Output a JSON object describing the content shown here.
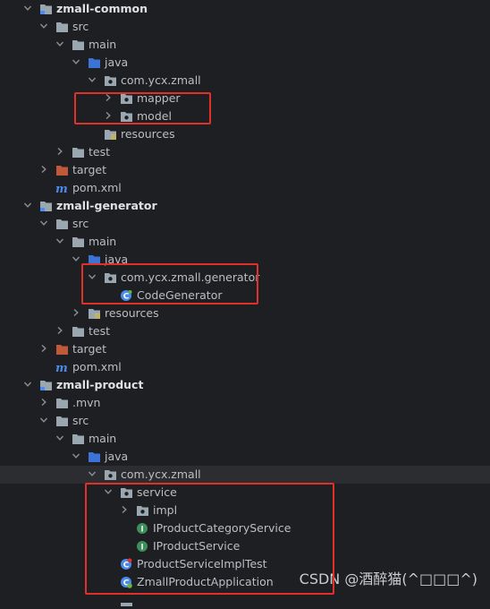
{
  "project_tree": {
    "rows": [
      {
        "label": "zmall-common",
        "depth": 0,
        "icon": "module-folder-icon",
        "expanded": true,
        "bold": true
      },
      {
        "label": "src",
        "depth": 1,
        "icon": "folder-icon",
        "expanded": true
      },
      {
        "label": "main",
        "depth": 2,
        "icon": "folder-icon",
        "expanded": true
      },
      {
        "label": "java",
        "depth": 3,
        "icon": "source-root-icon",
        "expanded": true
      },
      {
        "label": "com.ycx.zmall",
        "depth": 4,
        "icon": "package-icon",
        "expanded": true
      },
      {
        "label": "mapper",
        "depth": 5,
        "icon": "package-icon",
        "expanded": false
      },
      {
        "label": "model",
        "depth": 5,
        "icon": "package-icon",
        "expanded": false
      },
      {
        "label": "resources",
        "depth": 4,
        "icon": "resources-folder-icon"
      },
      {
        "label": "test",
        "depth": 2,
        "icon": "folder-icon",
        "expanded": false
      },
      {
        "label": "target",
        "depth": 1,
        "icon": "excluded-folder-icon",
        "expanded": false
      },
      {
        "label": "pom.xml",
        "depth": 1,
        "icon": "maven-icon"
      },
      {
        "label": "zmall-generator",
        "depth": 0,
        "icon": "module-folder-icon",
        "expanded": true,
        "bold": true
      },
      {
        "label": "src",
        "depth": 1,
        "icon": "folder-icon",
        "expanded": true
      },
      {
        "label": "main",
        "depth": 2,
        "icon": "folder-icon",
        "expanded": true
      },
      {
        "label": "java",
        "depth": 3,
        "icon": "source-root-icon",
        "expanded": true
      },
      {
        "label": "com.ycx.zmall.generator",
        "depth": 4,
        "icon": "package-icon",
        "expanded": true
      },
      {
        "label": "CodeGenerator",
        "depth": 5,
        "icon": "java-class-icon"
      },
      {
        "label": "resources",
        "depth": 3,
        "icon": "resources-folder-icon",
        "expanded": false
      },
      {
        "label": "test",
        "depth": 2,
        "icon": "folder-icon",
        "expanded": false
      },
      {
        "label": "target",
        "depth": 1,
        "icon": "excluded-folder-icon",
        "expanded": false
      },
      {
        "label": "pom.xml",
        "depth": 1,
        "icon": "maven-icon"
      },
      {
        "label": "zmall-product",
        "depth": 0,
        "icon": "module-folder-icon",
        "expanded": true,
        "bold": true
      },
      {
        "label": ".mvn",
        "depth": 1,
        "icon": "folder-icon",
        "expanded": false
      },
      {
        "label": "src",
        "depth": 1,
        "icon": "folder-icon",
        "expanded": true
      },
      {
        "label": "main",
        "depth": 2,
        "icon": "folder-icon",
        "expanded": true
      },
      {
        "label": "java",
        "depth": 3,
        "icon": "source-root-icon",
        "expanded": true
      },
      {
        "label": "com.ycx.zmall",
        "depth": 4,
        "icon": "package-icon",
        "expanded": true,
        "highlight": true
      },
      {
        "label": "service",
        "depth": 5,
        "icon": "package-icon",
        "expanded": true
      },
      {
        "label": "impl",
        "depth": 6,
        "icon": "package-icon",
        "expanded": false
      },
      {
        "label": "IProductCategoryService",
        "depth": 6,
        "icon": "java-interface-icon"
      },
      {
        "label": "IProductService",
        "depth": 6,
        "icon": "java-interface-icon"
      },
      {
        "label": "ProductServiceImplTest",
        "depth": 5,
        "icon": "java-test-class-icon"
      },
      {
        "label": "ZmallProductApplication",
        "depth": 5,
        "icon": "spring-boot-class-icon"
      },
      {
        "label": "",
        "depth": 5,
        "icon": "partial-row"
      }
    ]
  },
  "annotations": [
    {
      "name": "mapper-model-box",
      "rows": [
        5,
        6
      ]
    },
    {
      "name": "generator-package-box",
      "rows": [
        15,
        16
      ]
    },
    {
      "name": "service-box",
      "rows": [
        27,
        32
      ]
    }
  ],
  "watermark": "CSDN @酒醉猫(^□□□^)",
  "colors": {
    "background": "#1e1f22",
    "row_highlight": "#2b2d30",
    "text": "#bcbec4",
    "folder": "#9aa7b0",
    "source_root": "#3c73d6",
    "excluded": "#c0593a",
    "class": "#4a8be8",
    "interface": "#3d8f5a",
    "annotation_red": "#e0302a"
  }
}
